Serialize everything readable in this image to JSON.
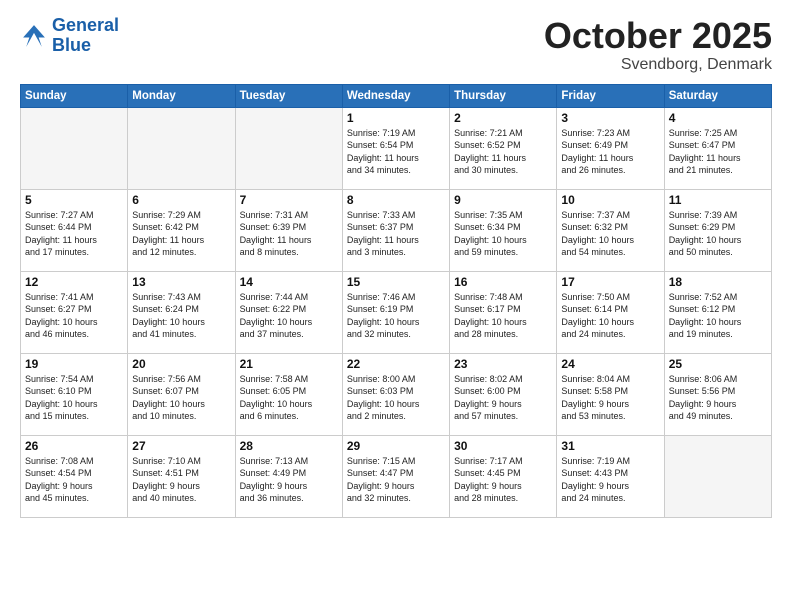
{
  "header": {
    "logo_line1": "General",
    "logo_line2": "Blue",
    "month": "October 2025",
    "location": "Svendborg, Denmark"
  },
  "days_of_week": [
    "Sunday",
    "Monday",
    "Tuesday",
    "Wednesday",
    "Thursday",
    "Friday",
    "Saturday"
  ],
  "weeks": [
    [
      {
        "day": "",
        "info": "",
        "empty": true
      },
      {
        "day": "",
        "info": "",
        "empty": true
      },
      {
        "day": "",
        "info": "",
        "empty": true
      },
      {
        "day": "1",
        "info": "Sunrise: 7:19 AM\nSunset: 6:54 PM\nDaylight: 11 hours\nand 34 minutes.",
        "empty": false
      },
      {
        "day": "2",
        "info": "Sunrise: 7:21 AM\nSunset: 6:52 PM\nDaylight: 11 hours\nand 30 minutes.",
        "empty": false
      },
      {
        "day": "3",
        "info": "Sunrise: 7:23 AM\nSunset: 6:49 PM\nDaylight: 11 hours\nand 26 minutes.",
        "empty": false
      },
      {
        "day": "4",
        "info": "Sunrise: 7:25 AM\nSunset: 6:47 PM\nDaylight: 11 hours\nand 21 minutes.",
        "empty": false
      }
    ],
    [
      {
        "day": "5",
        "info": "Sunrise: 7:27 AM\nSunset: 6:44 PM\nDaylight: 11 hours\nand 17 minutes.",
        "empty": false
      },
      {
        "day": "6",
        "info": "Sunrise: 7:29 AM\nSunset: 6:42 PM\nDaylight: 11 hours\nand 12 minutes.",
        "empty": false
      },
      {
        "day": "7",
        "info": "Sunrise: 7:31 AM\nSunset: 6:39 PM\nDaylight: 11 hours\nand 8 minutes.",
        "empty": false
      },
      {
        "day": "8",
        "info": "Sunrise: 7:33 AM\nSunset: 6:37 PM\nDaylight: 11 hours\nand 3 minutes.",
        "empty": false
      },
      {
        "day": "9",
        "info": "Sunrise: 7:35 AM\nSunset: 6:34 PM\nDaylight: 10 hours\nand 59 minutes.",
        "empty": false
      },
      {
        "day": "10",
        "info": "Sunrise: 7:37 AM\nSunset: 6:32 PM\nDaylight: 10 hours\nand 54 minutes.",
        "empty": false
      },
      {
        "day": "11",
        "info": "Sunrise: 7:39 AM\nSunset: 6:29 PM\nDaylight: 10 hours\nand 50 minutes.",
        "empty": false
      }
    ],
    [
      {
        "day": "12",
        "info": "Sunrise: 7:41 AM\nSunset: 6:27 PM\nDaylight: 10 hours\nand 46 minutes.",
        "empty": false
      },
      {
        "day": "13",
        "info": "Sunrise: 7:43 AM\nSunset: 6:24 PM\nDaylight: 10 hours\nand 41 minutes.",
        "empty": false
      },
      {
        "day": "14",
        "info": "Sunrise: 7:44 AM\nSunset: 6:22 PM\nDaylight: 10 hours\nand 37 minutes.",
        "empty": false
      },
      {
        "day": "15",
        "info": "Sunrise: 7:46 AM\nSunset: 6:19 PM\nDaylight: 10 hours\nand 32 minutes.",
        "empty": false
      },
      {
        "day": "16",
        "info": "Sunrise: 7:48 AM\nSunset: 6:17 PM\nDaylight: 10 hours\nand 28 minutes.",
        "empty": false
      },
      {
        "day": "17",
        "info": "Sunrise: 7:50 AM\nSunset: 6:14 PM\nDaylight: 10 hours\nand 24 minutes.",
        "empty": false
      },
      {
        "day": "18",
        "info": "Sunrise: 7:52 AM\nSunset: 6:12 PM\nDaylight: 10 hours\nand 19 minutes.",
        "empty": false
      }
    ],
    [
      {
        "day": "19",
        "info": "Sunrise: 7:54 AM\nSunset: 6:10 PM\nDaylight: 10 hours\nand 15 minutes.",
        "empty": false
      },
      {
        "day": "20",
        "info": "Sunrise: 7:56 AM\nSunset: 6:07 PM\nDaylight: 10 hours\nand 10 minutes.",
        "empty": false
      },
      {
        "day": "21",
        "info": "Sunrise: 7:58 AM\nSunset: 6:05 PM\nDaylight: 10 hours\nand 6 minutes.",
        "empty": false
      },
      {
        "day": "22",
        "info": "Sunrise: 8:00 AM\nSunset: 6:03 PM\nDaylight: 10 hours\nand 2 minutes.",
        "empty": false
      },
      {
        "day": "23",
        "info": "Sunrise: 8:02 AM\nSunset: 6:00 PM\nDaylight: 9 hours\nand 57 minutes.",
        "empty": false
      },
      {
        "day": "24",
        "info": "Sunrise: 8:04 AM\nSunset: 5:58 PM\nDaylight: 9 hours\nand 53 minutes.",
        "empty": false
      },
      {
        "day": "25",
        "info": "Sunrise: 8:06 AM\nSunset: 5:56 PM\nDaylight: 9 hours\nand 49 minutes.",
        "empty": false
      }
    ],
    [
      {
        "day": "26",
        "info": "Sunrise: 7:08 AM\nSunset: 4:54 PM\nDaylight: 9 hours\nand 45 minutes.",
        "empty": false
      },
      {
        "day": "27",
        "info": "Sunrise: 7:10 AM\nSunset: 4:51 PM\nDaylight: 9 hours\nand 40 minutes.",
        "empty": false
      },
      {
        "day": "28",
        "info": "Sunrise: 7:13 AM\nSunset: 4:49 PM\nDaylight: 9 hours\nand 36 minutes.",
        "empty": false
      },
      {
        "day": "29",
        "info": "Sunrise: 7:15 AM\nSunset: 4:47 PM\nDaylight: 9 hours\nand 32 minutes.",
        "empty": false
      },
      {
        "day": "30",
        "info": "Sunrise: 7:17 AM\nSunset: 4:45 PM\nDaylight: 9 hours\nand 28 minutes.",
        "empty": false
      },
      {
        "day": "31",
        "info": "Sunrise: 7:19 AM\nSunset: 4:43 PM\nDaylight: 9 hours\nand 24 minutes.",
        "empty": false
      },
      {
        "day": "",
        "info": "",
        "empty": true
      }
    ]
  ]
}
